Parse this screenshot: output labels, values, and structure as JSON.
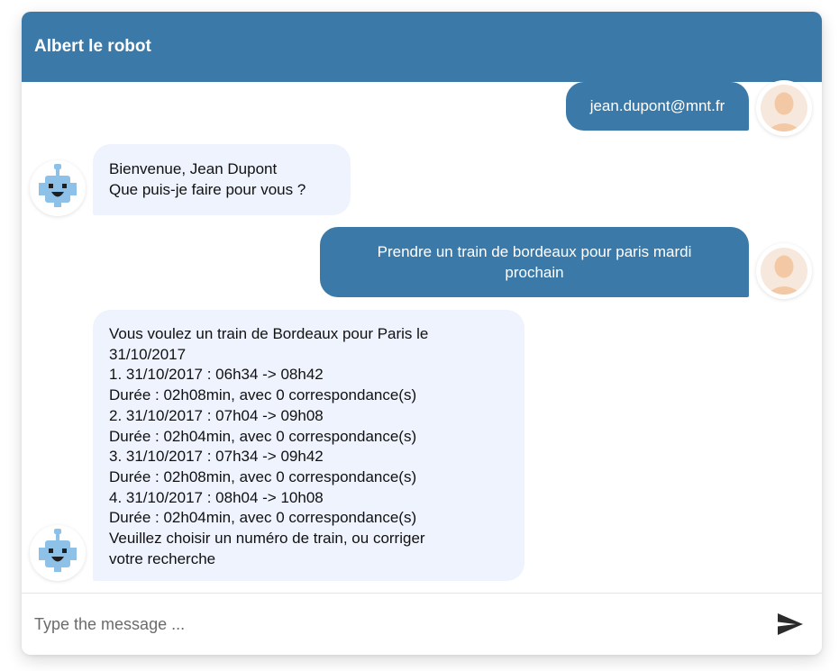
{
  "header": {
    "title": "Albert le robot"
  },
  "messages": [
    {
      "sender": "user",
      "lines": [
        "jean.dupont@mnt.fr"
      ]
    },
    {
      "sender": "bot",
      "lines": [
        "Bienvenue, Jean Dupont",
        "Que puis-je faire pour vous ?"
      ]
    },
    {
      "sender": "user",
      "lines": [
        "Prendre un train de bordeaux pour paris mardi",
        "prochain"
      ]
    },
    {
      "sender": "bot",
      "lines": [
        "Vous voulez un train de Bordeaux pour Paris le",
        "31/10/2017",
        "1. 31/10/2017 : 06h34 -> 08h42",
        "Durée : 02h08min, avec 0 correspondance(s)",
        "2. 31/10/2017 : 07h04 -> 09h08",
        "Durée : 02h04min, avec 0 correspondance(s)",
        "3. 31/10/2017 : 07h34 -> 09h42",
        "Durée : 02h08min, avec 0 correspondance(s)",
        "4. 31/10/2017 : 08h04 -> 10h08",
        "Durée : 02h04min, avec 0 correspondance(s)",
        "Veuillez choisir un numéro de train, ou corriger",
        "votre recherche"
      ]
    }
  ],
  "composer": {
    "placeholder": "Type the message ..."
  },
  "icons": {
    "user_avatar": "user-avatar-icon",
    "bot_avatar": "robot-avatar-icon",
    "send": "send-icon"
  },
  "colors": {
    "header": "#3b7aa8",
    "user_bubble": "#3b7aa8",
    "bot_bubble": "#eef3fe",
    "robot": "#8ec1e8"
  }
}
